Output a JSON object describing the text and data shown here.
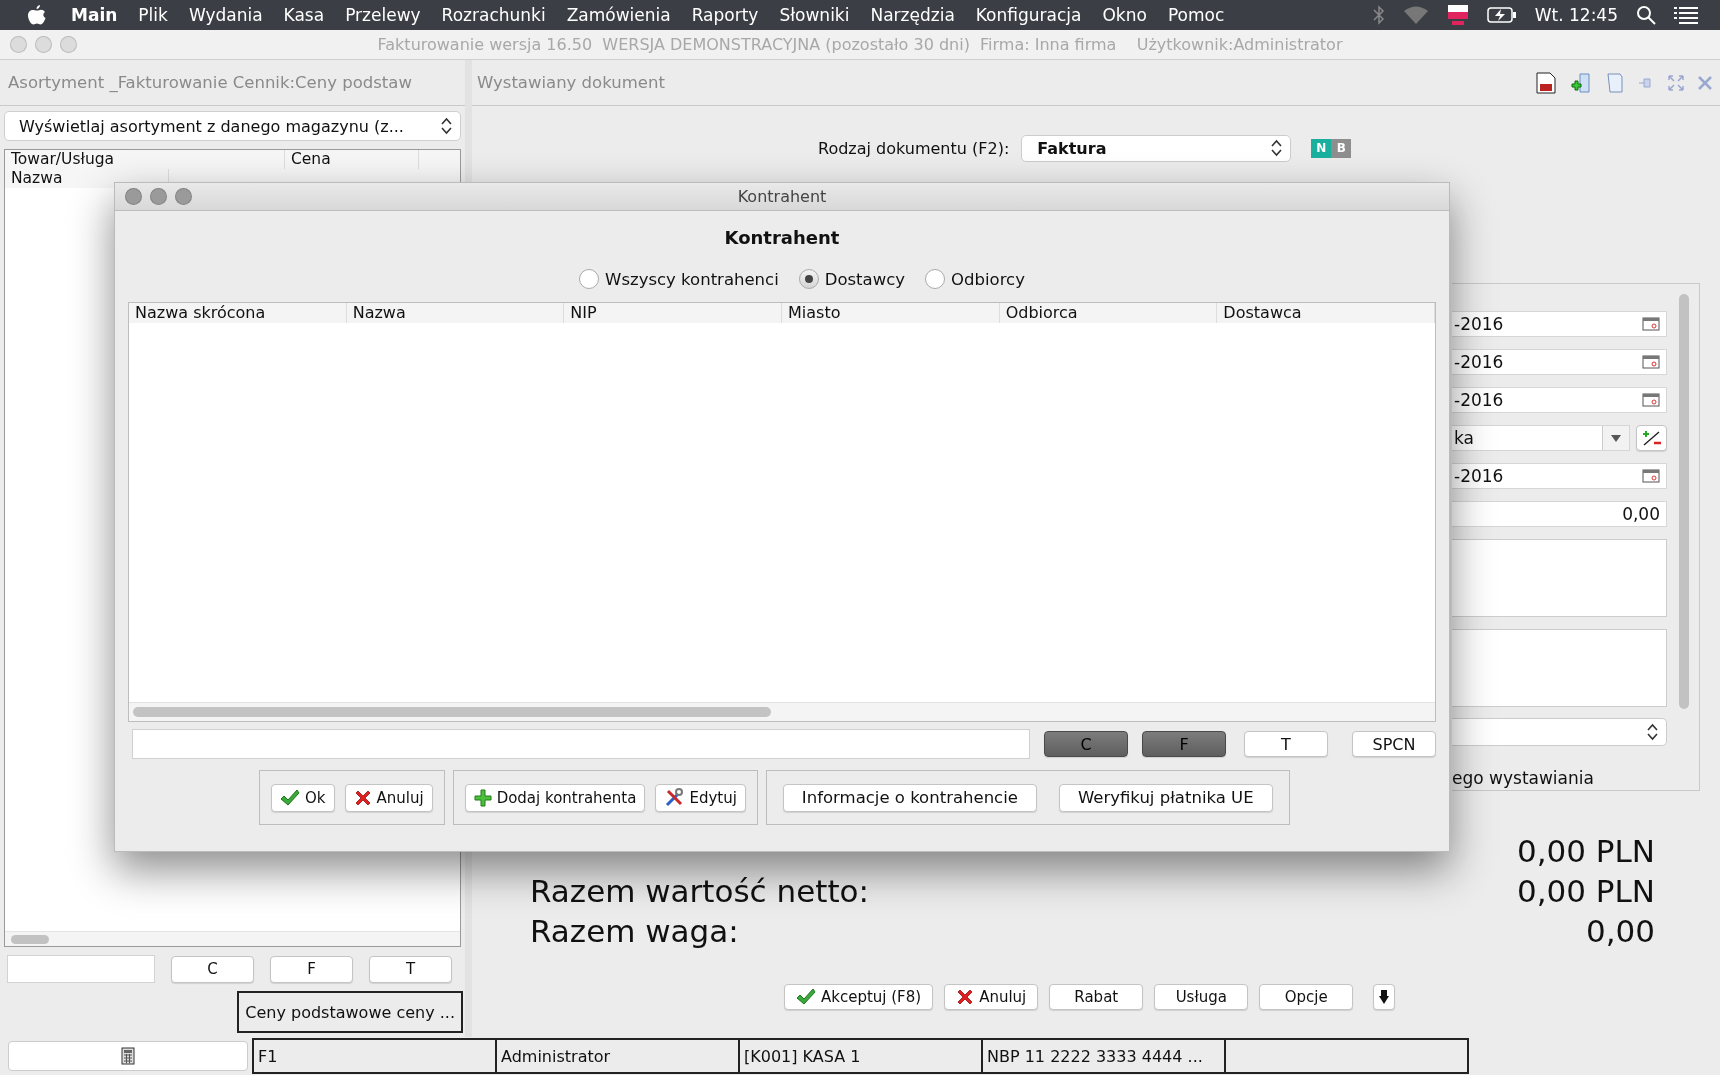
{
  "menu_bar": {
    "app": "Main",
    "items": [
      "Plik",
      "Wydania",
      "Kasa",
      "Przelewy",
      "Rozrachunki",
      "Zamówienia",
      "Raporty",
      "Słowniki",
      "Narzędzia",
      "Konfiguracja",
      "Okno",
      "Pomoc"
    ],
    "clock": "Wt. 12:45"
  },
  "window": {
    "title": "Fakturowanie wersja 16.50  WERSJA DEMONSTRACYJNA (pozostało 30 dni)  Firma: Inna firma    Użytkownik:Administrator"
  },
  "assortment_panel": {
    "title": "Asortyment _Fakturowanie Cennik:Ceny podstaw",
    "filter_select": "Wyświetlaj asortyment z danego magazynu (z...",
    "table": {
      "group_headers": [
        "Towar/Usługa",
        "Cena"
      ],
      "columns": [
        "Nazwa"
      ]
    },
    "filter_buttons": [
      {
        "label": "C",
        "selected": false
      },
      {
        "label": "F",
        "selected": false
      },
      {
        "label": "T",
        "selected": false
      }
    ],
    "price_list": "Ceny podstawowe ceny ..."
  },
  "document_panel": {
    "title": "Wystawiany dokument",
    "document_type_label": "Rodzaj dokumentu (F2):",
    "document_type": "Faktura",
    "badges": [
      {
        "label": "N",
        "selected": true
      },
      {
        "label": "B",
        "selected": false
      }
    ],
    "form_fields": [
      {
        "kind": "date",
        "value": "-2016"
      },
      {
        "kind": "date",
        "value": "-2016"
      },
      {
        "kind": "date",
        "value": "-2016"
      },
      {
        "kind": "select",
        "value": "ka"
      },
      {
        "kind": "date",
        "value": "-2016"
      },
      {
        "kind": "number",
        "value": "0,00"
      },
      {
        "kind": "textarea"
      },
      {
        "kind": "textarea"
      },
      {
        "kind": "combo"
      },
      {
        "kind": "label",
        "value": "ego wystawiania"
      }
    ],
    "totals": [
      {
        "value": "0,00 PLN"
      },
      {
        "label": "Razem wartość netto:",
        "value": "0,00 PLN"
      },
      {
        "label": "Razem waga:",
        "value": "0,00"
      }
    ],
    "buttons": [
      {
        "kind": "accept",
        "label": "Akceptuj (F8)"
      },
      {
        "kind": "cancel",
        "label": "Anuluj"
      },
      {
        "kind": "plain",
        "label": "Rabat"
      },
      {
        "kind": "plain",
        "label": "Usługa"
      },
      {
        "kind": "plain",
        "label": "Opcje"
      },
      {
        "kind": "arrow"
      }
    ]
  },
  "status_bar": {
    "cells": [
      "F1",
      "Administrator",
      "[K001] KASA 1",
      "NBP  11 2222 3333 4444 ...",
      ""
    ]
  },
  "dialog": {
    "title": "Kontrahent",
    "heading": "Kontrahent",
    "filters": [
      {
        "label": "Wszyscy kontrahenci",
        "selected": false
      },
      {
        "label": "Dostawcy",
        "selected": true
      },
      {
        "label": "Odbiorcy",
        "selected": false
      }
    ],
    "table": {
      "columns": [
        "Nazwa skrócona",
        "Nazwa",
        "NIP",
        "Miasto",
        "Odbiorca",
        "Dostawca"
      ]
    },
    "toggle_buttons": [
      {
        "label": "C",
        "selected": true
      },
      {
        "label": "F",
        "selected": true
      },
      {
        "label": "T",
        "selected": false
      },
      {
        "label": "SPCN",
        "selected": false
      }
    ],
    "button_groups": [
      [
        {
          "kind": "accept",
          "label": "Ok"
        },
        {
          "kind": "cancel",
          "label": "Anuluj"
        }
      ],
      [
        {
          "kind": "add",
          "label": "Dodaj kontrahenta"
        },
        {
          "kind": "edit",
          "label": "Edytuj"
        }
      ],
      [
        {
          "kind": "plain",
          "label": "Informacje o kontrahencie"
        },
        {
          "kind": "plain",
          "label": "Weryfikuj płatnika UE"
        }
      ]
    ]
  }
}
